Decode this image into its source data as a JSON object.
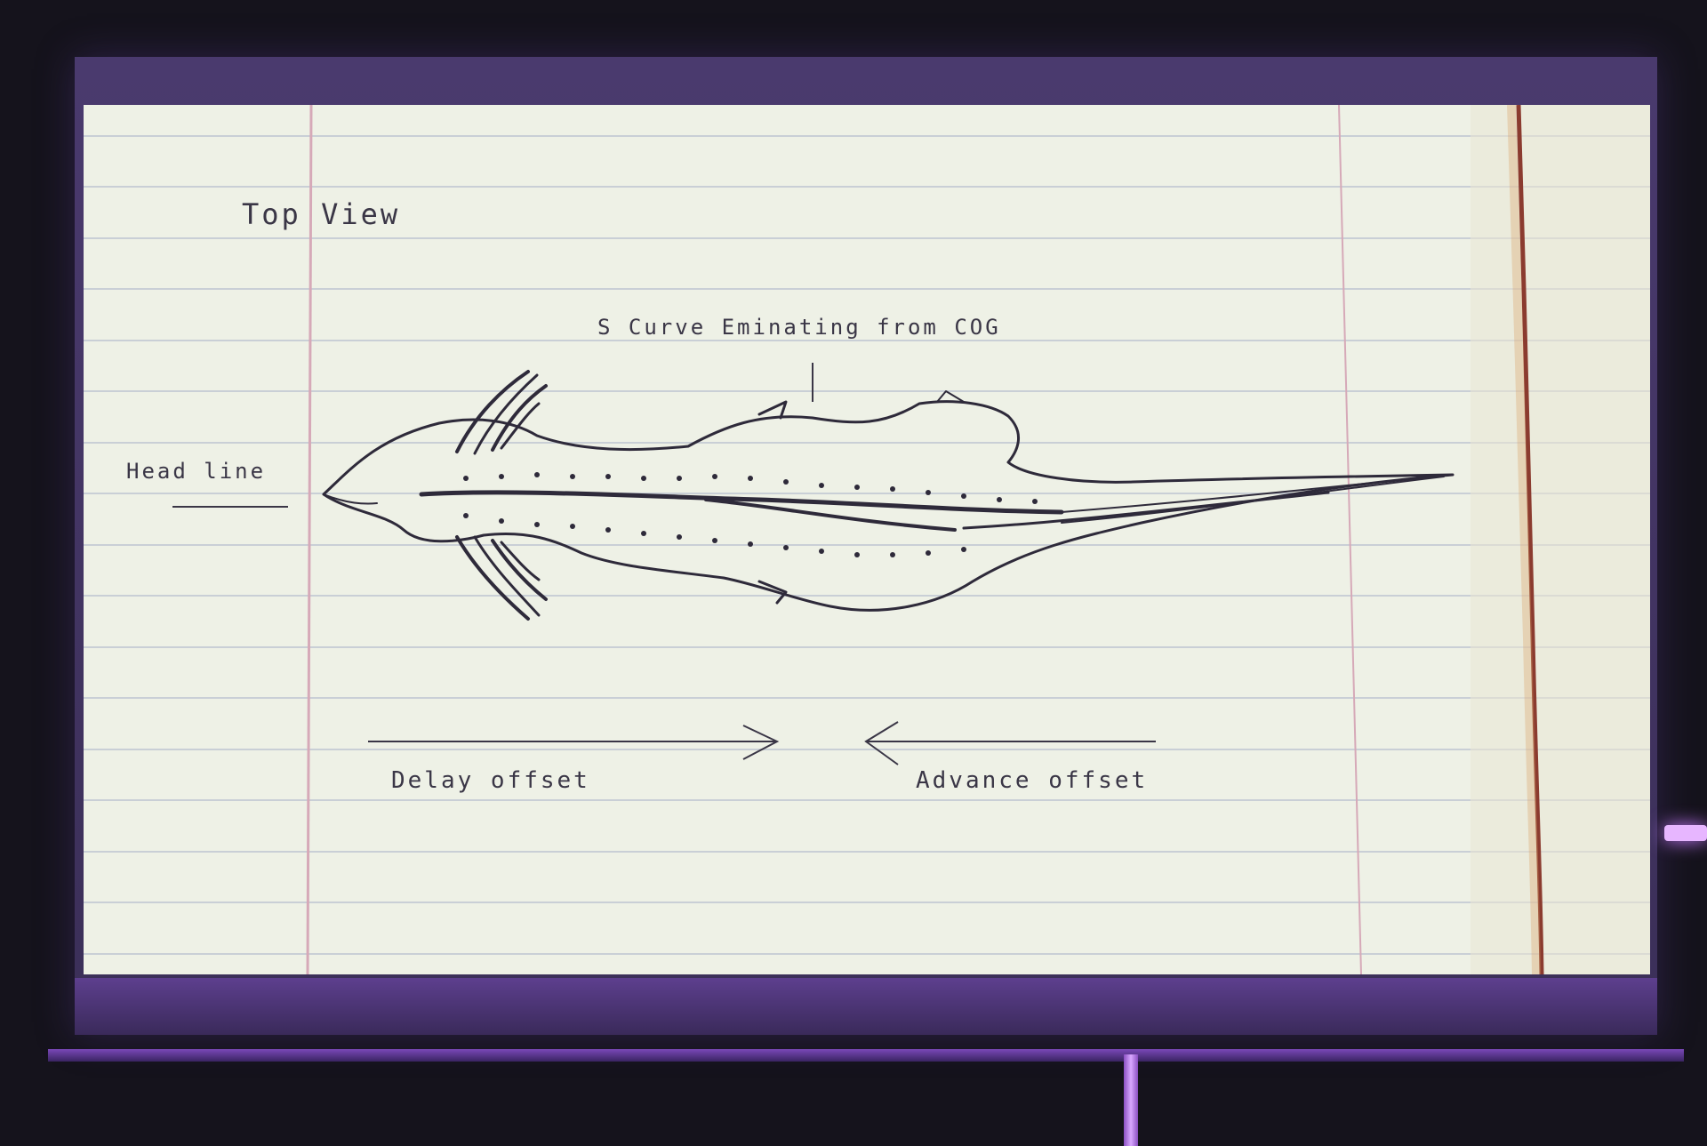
{
  "slide": {
    "title": "Top View",
    "annotation_top": "S Curve Eminating from COG",
    "head_label": "Head line",
    "delay_label": "Delay offset",
    "advance_label": "Advance offset"
  },
  "colors": {
    "paper": "#eef1e6",
    "rule_line": "#c9cfd6",
    "margin_line": "#d6a9b8",
    "ink": "#2e2a3a",
    "projector_glow": "#c77bff"
  }
}
